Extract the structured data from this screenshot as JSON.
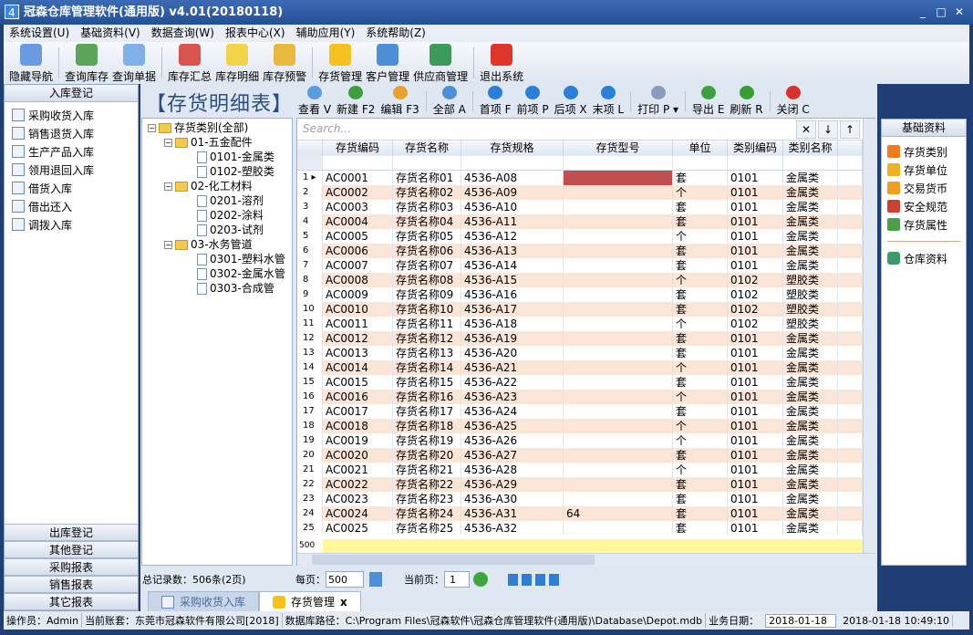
{
  "window": {
    "title": "冠森仓库管理软件(通用版) v4.01(20180118)",
    "minimize": "_",
    "maximize": "□",
    "close": "✕"
  },
  "menu": [
    "系统设置(U)",
    "基础资料(V)",
    "数据查询(W)",
    "报表中心(X)",
    "辅助应用(Y)",
    "系统帮助(Z)"
  ],
  "toolbar": [
    {
      "label": "隐藏导航",
      "icon": "monitor-icon",
      "color": "#6a9be0"
    },
    {
      "label": "查询库存",
      "icon": "house-search-icon",
      "color": "#5aa55a"
    },
    {
      "label": "查询单据",
      "icon": "document-search-icon",
      "color": "#7fb0e8"
    },
    {
      "label": "库存汇总",
      "icon": "chart-document-icon",
      "color": "#d9534f"
    },
    {
      "label": "库存明细",
      "icon": "clipboard-icon",
      "color": "#f2d34a"
    },
    {
      "label": "库存预警",
      "icon": "clock-document-icon",
      "color": "#e8b93c"
    },
    {
      "label": "存货管理",
      "icon": "box-icon",
      "color": "#f4c21a"
    },
    {
      "label": "客户管理",
      "icon": "contact-card-icon",
      "color": "#4d8fd6"
    },
    {
      "label": "供应商管理",
      "icon": "supplier-card-icon",
      "color": "#3d9a5c"
    },
    {
      "label": "退出系统",
      "icon": "no-entry-icon",
      "color": "#e0352b"
    }
  ],
  "left_nav": {
    "header": "入库登记",
    "items": [
      "采购收货入库",
      "销售退货入库",
      "生产产品入库",
      "领用退回入库",
      "借货入库",
      "借出还入",
      "调拨入库"
    ],
    "bottom": [
      "出库登记",
      "其他登记",
      "采购报表",
      "销售报表",
      "其它报表"
    ]
  },
  "page_title": "【存货明细表】",
  "grid_toolbar": [
    {
      "label": "查看 V",
      "icon": "magnifier-icon",
      "color": "#5b9be0"
    },
    {
      "label": "新建 F2",
      "icon": "new-document-icon",
      "color": "#3ca13c"
    },
    {
      "label": "编辑 F3",
      "icon": "pencil-icon",
      "color": "#e8a030"
    },
    {
      "label": "全部 A",
      "icon": "grid-icon",
      "color": "#4d8fd6"
    },
    {
      "label": "首项 F",
      "icon": "first-icon",
      "color": "#2a7fd8"
    },
    {
      "label": "前项 P",
      "icon": "previous-icon",
      "color": "#2a7fd8"
    },
    {
      "label": "后项 X",
      "icon": "next-icon",
      "color": "#2a7fd8"
    },
    {
      "label": "末项 L",
      "icon": "last-icon",
      "color": "#2a7fd8"
    },
    {
      "label": "打印 P ▾",
      "icon": "printer-icon",
      "color": "#8a9bc0"
    },
    {
      "label": "导出 E",
      "icon": "export-icon",
      "color": "#3ca13c"
    },
    {
      "label": "刷新 R",
      "icon": "refresh-icon",
      "color": "#34a034"
    },
    {
      "label": "关闭 C",
      "icon": "close-circle-icon",
      "color": "#d9302a"
    }
  ],
  "tree": {
    "root": "存货类别(全部)",
    "groups": [
      {
        "label": "01-五金配件",
        "children": [
          "0101-金属类",
          "0102-塑胶类"
        ]
      },
      {
        "label": "02-化工材料",
        "children": [
          "0201-溶剂",
          "0202-涂料",
          "0203-试剂"
        ]
      },
      {
        "label": "03-水务管道",
        "children": [
          "0301-塑料水管",
          "0302-金属水管",
          "0303-合成管"
        ]
      }
    ]
  },
  "grid": {
    "search_placeholder": "Search...",
    "clear": "✕",
    "down": "↓",
    "up": "↑",
    "columns": [
      "存货编码",
      "存货名称",
      "存货规格",
      "存货型号",
      "单位",
      "类别编码",
      "类别名称"
    ],
    "selected_cell_color": "#c0504d",
    "alt_row_color": "#fbe5d6",
    "footer_label": "500",
    "rows": [
      [
        "AC0001",
        "存货名称01",
        "4536-A08",
        "",
        "套",
        "0101",
        "金属类"
      ],
      [
        "AC0002",
        "存货名称02",
        "4536-A09",
        "",
        "个",
        "0101",
        "金属类"
      ],
      [
        "AC0003",
        "存货名称03",
        "4536-A10",
        "",
        "套",
        "0101",
        "金属类"
      ],
      [
        "AC0004",
        "存货名称04",
        "4536-A11",
        "",
        "套",
        "0101",
        "金属类"
      ],
      [
        "AC0005",
        "存货名称05",
        "4536-A12",
        "",
        "个",
        "0101",
        "金属类"
      ],
      [
        "AC0006",
        "存货名称06",
        "4536-A13",
        "",
        "套",
        "0101",
        "金属类"
      ],
      [
        "AC0007",
        "存货名称07",
        "4536-A14",
        "",
        "套",
        "0101",
        "金属类"
      ],
      [
        "AC0008",
        "存货名称08",
        "4536-A15",
        "",
        "个",
        "0102",
        "塑胶类"
      ],
      [
        "AC0009",
        "存货名称09",
        "4536-A16",
        "",
        "套",
        "0102",
        "塑胶类"
      ],
      [
        "AC0010",
        "存货名称10",
        "4536-A17",
        "",
        "套",
        "0102",
        "塑胶类"
      ],
      [
        "AC0011",
        "存货名称11",
        "4536-A18",
        "",
        "个",
        "0102",
        "塑胶类"
      ],
      [
        "AC0012",
        "存货名称12",
        "4536-A19",
        "",
        "套",
        "0101",
        "金属类"
      ],
      [
        "AC0013",
        "存货名称13",
        "4536-A20",
        "",
        "套",
        "0101",
        "金属类"
      ],
      [
        "AC0014",
        "存货名称14",
        "4536-A21",
        "",
        "个",
        "0101",
        "金属类"
      ],
      [
        "AC0015",
        "存货名称15",
        "4536-A22",
        "",
        "套",
        "0101",
        "金属类"
      ],
      [
        "AC0016",
        "存货名称16",
        "4536-A23",
        "",
        "个",
        "0101",
        "金属类"
      ],
      [
        "AC0017",
        "存货名称17",
        "4536-A24",
        "",
        "套",
        "0101",
        "金属类"
      ],
      [
        "AC0018",
        "存货名称18",
        "4536-A25",
        "",
        "个",
        "0101",
        "金属类"
      ],
      [
        "AC0019",
        "存货名称19",
        "4536-A26",
        "",
        "个",
        "0101",
        "金属类"
      ],
      [
        "AC0020",
        "存货名称20",
        "4536-A27",
        "",
        "套",
        "0101",
        "金属类"
      ],
      [
        "AC0021",
        "存货名称21",
        "4536-A28",
        "",
        "个",
        "0101",
        "金属类"
      ],
      [
        "AC0022",
        "存货名称22",
        "4536-A29",
        "",
        "套",
        "0101",
        "金属类"
      ],
      [
        "AC0023",
        "存货名称23",
        "4536-A30",
        "",
        "套",
        "0101",
        "金属类"
      ],
      [
        "AC0024",
        "存货名称24",
        "4536-A31",
        "64",
        "套",
        "0101",
        "金属类"
      ],
      [
        "AC0025",
        "存货名称25",
        "4536-A32",
        "",
        "套",
        "0101",
        "金属类"
      ]
    ]
  },
  "right_panel": {
    "header": "基础资料",
    "items": [
      {
        "label": "存货类别",
        "icon": "category-icon",
        "color": "#f07a20"
      },
      {
        "label": "存货单位",
        "icon": "ruler-icon",
        "color": "#f0b020"
      },
      {
        "label": "交易货币",
        "icon": "yen-icon",
        "color": "#f0a020"
      },
      {
        "label": "安全规范",
        "icon": "shield-icon",
        "color": "#d04030"
      },
      {
        "label": "存货属性",
        "icon": "stack-icon",
        "color": "#4aa04a"
      }
    ],
    "extra": {
      "label": "仓库资料",
      "icon": "warehouse-icon",
      "color": "#3a9a6a"
    }
  },
  "pager": {
    "total": "总记录数：506条(2页)",
    "per_page_label": "每页：",
    "per_page": "500",
    "current_label": "当前页：",
    "current": "1"
  },
  "tabs": [
    {
      "label": "采购收货入库",
      "active": false
    },
    {
      "label": "存货管理",
      "active": true,
      "close": "x"
    }
  ],
  "status": {
    "operator": "操作员：Admin",
    "account": "当前账套：东莞市冠森软件有限公司[2018]",
    "db": "数据库路径：C:\\Program Files\\冠森软件\\冠森仓库管理软件(通用版)\\Database\\Depot.mdb",
    "date_label": "业务日期：",
    "date": "2018-01-18",
    "clock": "2018-01-18 10:49:10"
  }
}
